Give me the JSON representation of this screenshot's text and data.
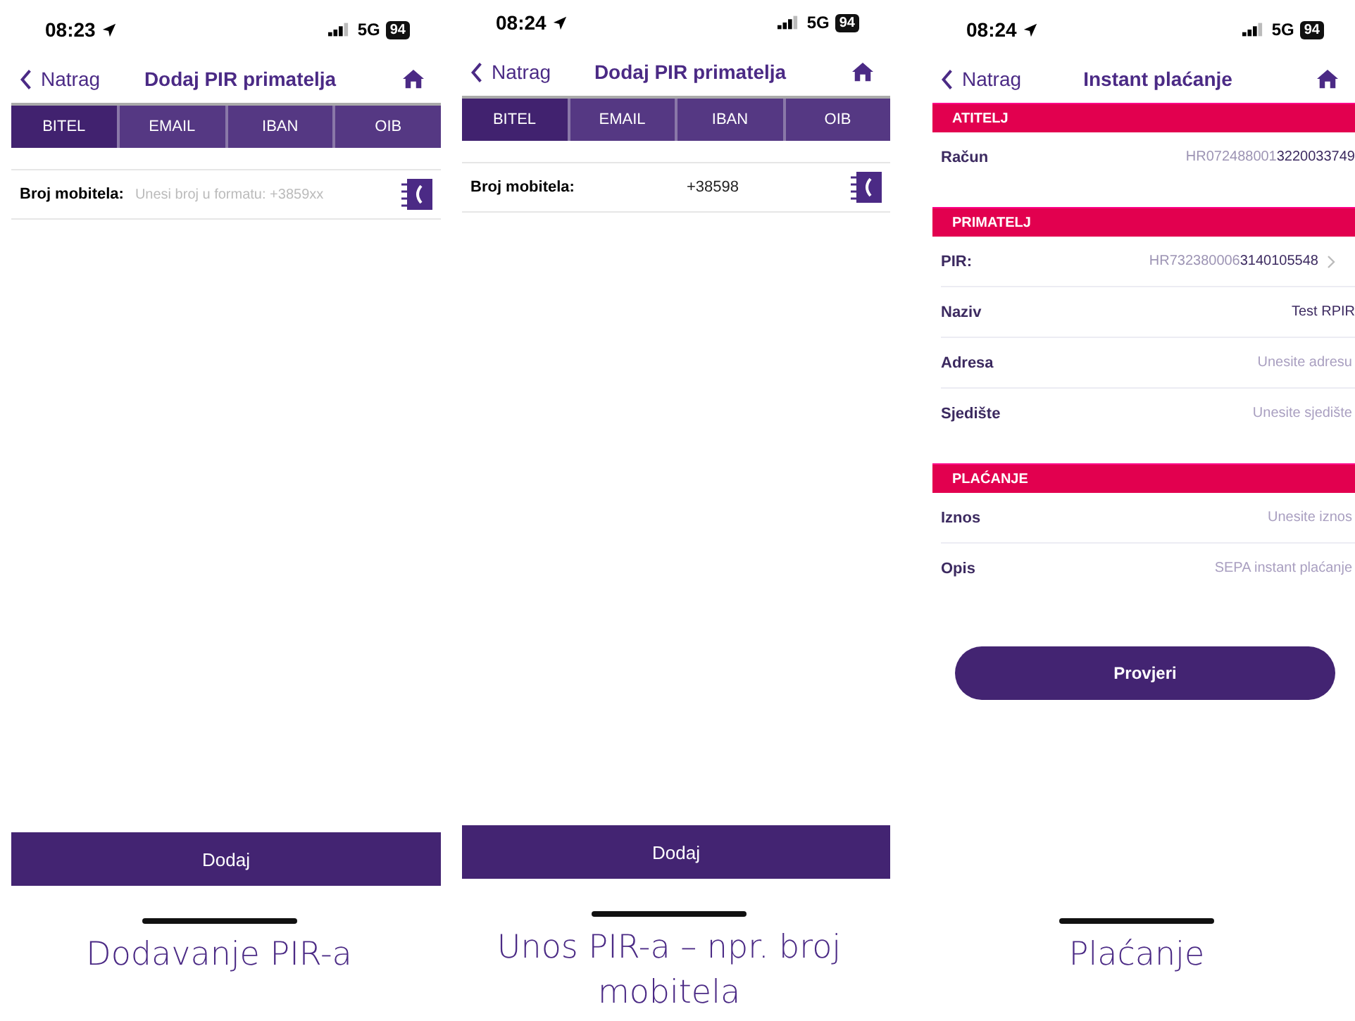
{
  "screens": [
    {
      "kind": "form",
      "status": {
        "time": "08:23",
        "network": "5G",
        "battery": "94"
      },
      "nav": {
        "back": "Natrag",
        "title": "Dodaj PIR primatelja"
      },
      "tabs": [
        {
          "label": "BITEL",
          "selected": true
        },
        {
          "label": "EMAIL",
          "selected": false
        },
        {
          "label": "IBAN",
          "selected": false
        },
        {
          "label": "OIB",
          "selected": false
        }
      ],
      "field": {
        "label": "Broj mobitela:",
        "placeholder": "Unesi broj u formatu: +3859xx"
      },
      "button": "Dodaj",
      "caption": "Dodavanje PIR-a"
    },
    {
      "kind": "form",
      "status": {
        "time": "08:24",
        "network": "5G",
        "battery": "94"
      },
      "nav": {
        "back": "Natrag",
        "title": "Dodaj PIR primatelja"
      },
      "tabs": [
        {
          "label": "BITEL",
          "selected": true
        },
        {
          "label": "EMAIL",
          "selected": false
        },
        {
          "label": "IBAN",
          "selected": false
        },
        {
          "label": "OIB",
          "selected": false
        }
      ],
      "field": {
        "label": "Broj mobitela:",
        "value": "+38598"
      },
      "button": "Dodaj",
      "caption": "Unos PIR-a – npr. broj mobitela"
    },
    {
      "kind": "payment",
      "status": {
        "time": "08:24",
        "network": "5G",
        "battery": "94"
      },
      "nav": {
        "back": "Natrag",
        "title": "Instant plaćanje"
      },
      "sections": [
        {
          "header": "ATITELJ",
          "rows": [
            {
              "label": "Račun",
              "value_prefix": "HR072488001",
              "value": "3220033749"
            }
          ]
        },
        {
          "header": "PRIMATELJ",
          "rows": [
            {
              "label": "PIR:",
              "value_prefix": "HR732380006",
              "value": "3140105548",
              "chevron": true
            },
            {
              "label": "Naziv",
              "value": "Test RPIR"
            },
            {
              "label": "Adresa",
              "placeholder": "Unesite adresu"
            },
            {
              "label": "Sjedište",
              "placeholder": "Unesite sjedište"
            }
          ]
        },
        {
          "header": "PLAĆANJE",
          "rows": [
            {
              "label": "Iznos",
              "placeholder": "Unesite iznos"
            },
            {
              "label": "Opis",
              "placeholder": "SEPA instant plaćanje"
            }
          ]
        }
      ],
      "button": "Provjeri",
      "caption": "Plaćanje"
    }
  ]
}
